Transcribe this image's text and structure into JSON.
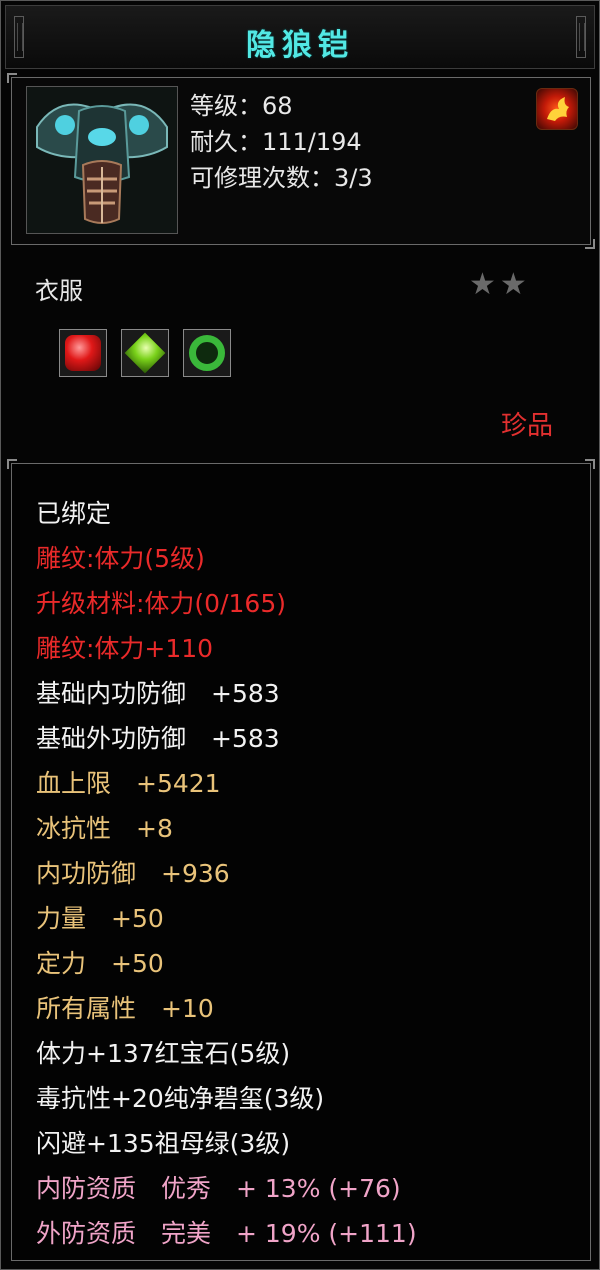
{
  "title": "隐狼铠",
  "icons": {
    "portrait": "armor-portrait-icon",
    "badge": "flame-icon",
    "stars": "star-icon"
  },
  "colors": {
    "title": "#52e8e4",
    "normal": "#f2f2f2",
    "engrave": "#ea2a2a",
    "attribute": "#e9c37a",
    "aptitude": "#f0a4c8",
    "quality": "#e23030"
  },
  "header": {
    "level": "等级：68",
    "durability": "耐久：111/194",
    "repairs": "可修理次数：3/3"
  },
  "item_type": "衣服",
  "star_count": 2,
  "stars_text": "★★",
  "gems": [
    "red-gem-icon",
    "green-gem-icon",
    "jade-ring-icon"
  ],
  "quality": "珍品",
  "attributes": [
    {
      "text": "已绑定",
      "style": "white"
    },
    {
      "text": "雕纹:体力(5级)",
      "style": "red"
    },
    {
      "text": "升级材料:体力(0/165)",
      "style": "red"
    },
    {
      "text": "雕纹:体力+110",
      "style": "red"
    },
    {
      "text": "基础内功防御　+583",
      "style": "white"
    },
    {
      "text": "基础外功防御　+583",
      "style": "white"
    },
    {
      "text": "血上限　+5421",
      "style": "tan"
    },
    {
      "text": "冰抗性　+8",
      "style": "tan"
    },
    {
      "text": "内功防御　+936",
      "style": "tan"
    },
    {
      "text": "力量　+50",
      "style": "tan"
    },
    {
      "text": "定力　+50",
      "style": "tan"
    },
    {
      "text": "所有属性　+10",
      "style": "tan"
    },
    {
      "text": "体力+137红宝石(5级)",
      "style": "white"
    },
    {
      "text": "毒抗性+20纯净碧玺(3级)",
      "style": "white"
    },
    {
      "text": "闪避+135祖母绿(3级)",
      "style": "white"
    },
    {
      "text": "内防资质　优秀　+ 13% (+76)",
      "style": "pink"
    },
    {
      "text": "外防资质　完美　+ 19% (+111)",
      "style": "pink"
    }
  ]
}
